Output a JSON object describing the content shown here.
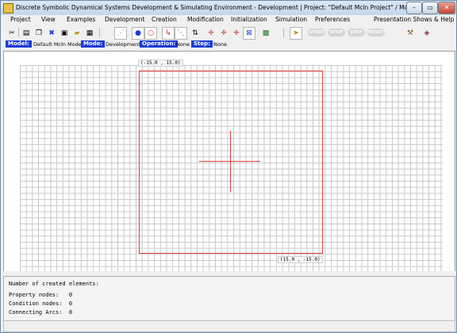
{
  "window": {
    "title": "Discrete Symbolic Dynamical Systems Development & Simulating Environment - Development  | Project: \"Default Mcln Project\" / Model: \"Default Mcln",
    "controls": {
      "minimize": "–",
      "maximize": "▭",
      "close": "✕"
    }
  },
  "menu": [
    "Project",
    "View",
    "Examples",
    "Development",
    "Creation",
    "Modification",
    "Initialization",
    "Simulation",
    "Preferences",
    "Presentation Shows & Help"
  ],
  "toolbar": {
    "icons": [
      "scissors-icon",
      "document-icon",
      "copy-icon",
      "close-doc-icon",
      "save-icon",
      "open-folder-icon",
      "print-icon",
      "arc-tool-icon",
      "property-node-icon",
      "condition-node-icon",
      "connect-icon",
      "group-icon",
      "arrows-icon",
      "align-left-icon",
      "align-center-icon",
      "align-right-icon",
      "align-box-icon",
      "calculator-icon",
      "run-icon",
      "tools-icon",
      "book-icon"
    ],
    "sim_buttons": [
      "START",
      "STOP",
      "STEP",
      "RESET"
    ]
  },
  "status": {
    "model_label": "Model:",
    "model_value": "Default Mcln Model",
    "mode_label": "Mode:",
    "mode_value": "Development",
    "operation_label": "Operation:",
    "operation_value": "None",
    "step_label": "Step:",
    "step_value": "None"
  },
  "canvas": {
    "top_left_coord": "(-15.0 , 15.0)",
    "bottom_right_coord": "(15.0 , -15.0)",
    "frame_color": "#e23b3b"
  },
  "console": {
    "header": "Number of created elements:",
    "lines": [
      "Property nodes:   0",
      "Condition nodes:  0",
      "Connecting Arcs:  0"
    ]
  }
}
